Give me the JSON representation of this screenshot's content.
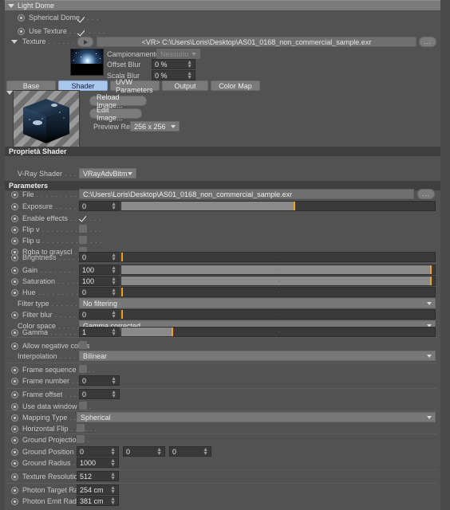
{
  "window": {
    "title": "Light Dome"
  },
  "top": {
    "spherical_dome": {
      "label": "Spherical Dome",
      "dots": ". . . .",
      "checked": true
    },
    "use_texture": {
      "label": "Use Texture",
      "dots": ". . . . . . . .",
      "checked": true
    },
    "texture": {
      "label": "Texture",
      "dots": ". . . . . . . . . . . .",
      "value": "<VR> C:\\Users\\Loris\\Desktop\\AS01_0168_non_commercial_sample.exr",
      "browse_label": "..."
    },
    "campionamento": {
      "label": "Campionamento",
      "value": "Nessuno"
    },
    "offset_blur": {
      "label": "Offset Blur",
      "value": "0 %"
    },
    "scala_blur": {
      "label": "Scala Blur",
      "value": "0 %"
    }
  },
  "tabs": [
    {
      "label": "Base",
      "selected": false
    },
    {
      "label": "Shader",
      "selected": true
    },
    {
      "label": "UVW Parameters",
      "selected": false
    },
    {
      "label": "Output",
      "selected": false
    },
    {
      "label": "Color Map",
      "selected": false
    }
  ],
  "preview": {
    "reload_label": "Reload Image...",
    "edit_label": "Edit Image...",
    "res_label": "Preview Res",
    "res_value": "256 x 256"
  },
  "shader_props": {
    "section_title": "Proprietà Shader",
    "vray_shader": {
      "label": "V-Ray Shader",
      "dots": ". . . . . .",
      "value": "VRayAdvBitmap"
    }
  },
  "parameters": {
    "section_title": "Parameters",
    "file": {
      "label": "File",
      "dots": ". . . . . . . . . . . . . .",
      "value": "C:\\Users\\Loris\\Desktop\\AS01_0168_non_commercial_sample.exr",
      "browse_label": "..."
    },
    "exposure": {
      "label": "Exposure",
      "dots": ". . . . . . . . . .",
      "value": "0",
      "fill_pct": 55,
      "handle_pct": 55
    },
    "enable_effects": {
      "label": "Enable effects",
      "dots": ". . . . . . .",
      "checked": true
    },
    "flip_v": {
      "label": "Flip v",
      "dots": ". . . . . . . . . . . . .",
      "checked": false
    },
    "flip_u": {
      "label": "Flip u",
      "dots": ". . . . . . . . . . . . .",
      "checked": false
    },
    "rgba_to_grayscale": {
      "label": "Rgba to grayscl",
      "dots": ". . . . .",
      "checked": false
    },
    "brightness": {
      "label": "Brightness",
      "dots": ". . . . . . . . . .",
      "value": "0",
      "fill_pct": 0,
      "handle_pct": 0
    },
    "gain": {
      "label": "Gain",
      "dots": ". . . . . . . . . . . . . .",
      "value": "100",
      "fill_pct": 99,
      "handle_pct": 99
    },
    "saturation": {
      "label": "Saturation",
      "dots": ". . . . . . . . .",
      "value": "100",
      "fill_pct": 99,
      "handle_pct": 99
    },
    "hue": {
      "label": "Hue",
      "dots": ". . . . . . . . . . . . . . .",
      "value": "0",
      "fill_pct": 0,
      "handle_pct": 0
    },
    "filter_type": {
      "label": "Filter type",
      "dots": ". . . . . . . . .",
      "value": "No filtering"
    },
    "filter_blur": {
      "label": "Filter blur",
      "dots": ". . . . . . . . . .",
      "value": "0",
      "fill_pct": 0,
      "handle_pct": 0
    },
    "color_space": {
      "label": "Color space",
      "dots": ". . . . . . . .",
      "value": "Gamma corrected"
    },
    "gamma": {
      "label": "Gamma",
      "dots": ". . . . . . . . . . .",
      "value": "1",
      "fill_pct": 16,
      "handle_pct": 16
    },
    "allow_negative_colors": {
      "label": "Allow negative colors",
      "dots": "",
      "checked": false
    },
    "interpolation": {
      "label": "Interpolation",
      "dots": ". . . . . . .",
      "value": "Bilinear"
    },
    "frame_sequence": {
      "label": "Frame sequence",
      "dots": ". . . .",
      "checked": false
    },
    "frame_number": {
      "label": "Frame number",
      "dots": ". . . . .",
      "value": "0"
    },
    "frame_offset": {
      "label": "Frame offset",
      "dots": ". . . . . . .",
      "value": "0"
    },
    "use_data_window": {
      "label": "Use data window",
      "dots": ". . .",
      "checked": false
    },
    "mapping_type": {
      "label": "Mapping Type",
      "dots": ". . . . . .",
      "value": "Spherical"
    },
    "horizontal_flip": {
      "label": "Horizontal Flip",
      "dots": ". . . . . .",
      "checked": false
    },
    "ground_projection": {
      "label": "Ground Projection",
      "dots": ". .",
      "checked": false
    },
    "ground_position": {
      "label": "Ground Position",
      "dots": ". . . .",
      "x": "0",
      "y": "0",
      "z": "0"
    },
    "ground_radius": {
      "label": "Ground Radius",
      "dots": ". . . . .",
      "value": "1000"
    },
    "texture_resolution": {
      "label": "Texture Resolution",
      "dots": ". .",
      "value": "512"
    },
    "photon_target_radius": {
      "label": "Photon Target Radius",
      "dots": "",
      "value": "254 cm"
    },
    "photon_emit_radius": {
      "label": "Photon Emit Radius",
      "dots": ".",
      "value": "381 cm"
    }
  },
  "colors": {
    "panel_bg": "#525252",
    "accent_tab": "#a9c6ec",
    "slider_handle": "#f0a01e",
    "section_bar": "#3f3f3f"
  }
}
